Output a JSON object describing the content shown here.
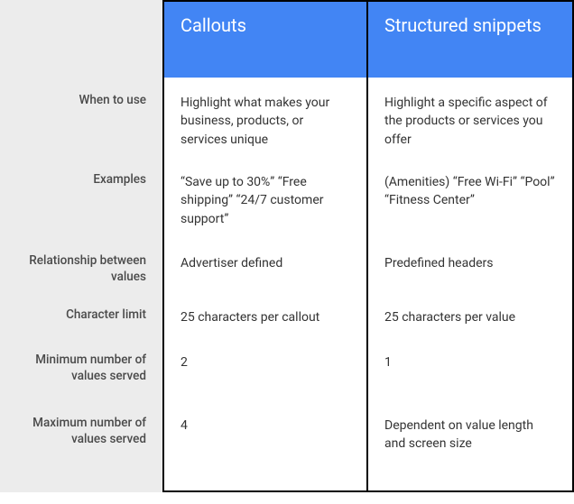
{
  "headers": {
    "callouts": "Callouts",
    "snippets": "Structured snippets"
  },
  "rows": {
    "when": {
      "label": "When to use",
      "callouts": "Highlight what makes your business, products, or services unique",
      "snippets": "Highlight a specific aspect of the products or services you offer"
    },
    "examples": {
      "label": "Examples",
      "callouts": "“Save up to 30%” “Free shipping” “24/7 customer support”",
      "snippets": "(Amenities) “Free Wi-Fi” “Pool” “Fitness Center”"
    },
    "relationship": {
      "label": "Relationship between values",
      "callouts": "Advertiser defined",
      "snippets": "Predefined headers"
    },
    "charlimit": {
      "label": "Character limit",
      "callouts": "25 characters per callout",
      "snippets": "25 characters per value"
    },
    "min": {
      "label": "Minimum number of values served",
      "callouts": "2",
      "snippets": "1"
    },
    "max": {
      "label": "Maximum number of values served",
      "callouts": "4",
      "snippets": "Dependent on value length and screen size"
    }
  }
}
